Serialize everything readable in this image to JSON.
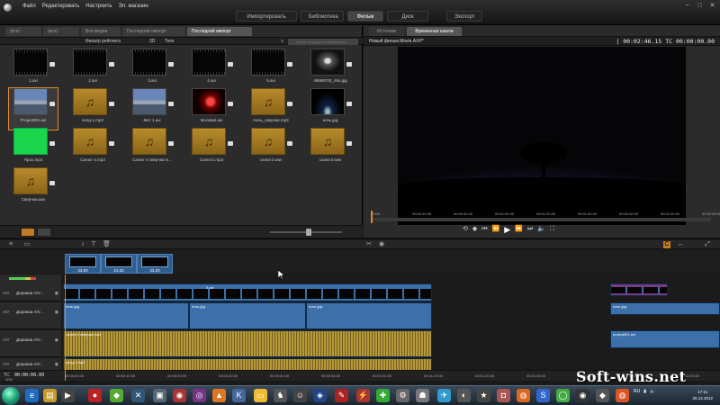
{
  "menu": {
    "items": [
      "Файл",
      "Редактировать",
      "Настроить",
      "Эл. магазин"
    ]
  },
  "window_controls": [
    "−",
    "□",
    "✕"
  ],
  "mode_tabs": {
    "import": "Импортировать",
    "library": "Библиотека",
    "movie": "Фильм",
    "disc": "Диск",
    "export": "Экспорт"
  },
  "library": {
    "tabs": [
      "(все)",
      "(все)",
      "Вся медиа",
      "Последний импорт",
      "Последний импорт"
    ],
    "rating_filter": "Фильтр рейтинга",
    "filter_3d": "3D",
    "filter_tags": "Теги",
    "search_placeholder": "Поиск текущих отображаемых",
    "items": [
      {
        "label": "1.avi",
        "kind": "film"
      },
      {
        "label": "2.avi",
        "kind": "film"
      },
      {
        "label": "3.avi",
        "kind": "film"
      },
      {
        "label": "4.avi",
        "kind": "film"
      },
      {
        "label": "5.avi",
        "kind": "film"
      },
      {
        "label": "49698700_n8o.jpg",
        "kind": "ufo"
      },
      {
        "label": "Project001.avi",
        "kind": "landscape"
      },
      {
        "label": "song-1.mp3",
        "kind": "audio"
      },
      {
        "label": "Мет 1.avi",
        "kind": "landscape"
      },
      {
        "label": "Москва2.avi",
        "kind": "rose"
      },
      {
        "label": "Ночь_сверчки.mp3",
        "kind": "audio"
      },
      {
        "label": "ночь.jpg",
        "kind": "night"
      },
      {
        "label": "Прох.mp4",
        "kind": "green"
      },
      {
        "label": "Салют 4.mp3",
        "kind": "audio"
      },
      {
        "label": "Салют и сверчки.m...",
        "kind": "audio"
      },
      {
        "label": "Салют1.mp3",
        "kind": "audio"
      },
      {
        "label": "салют2.wav",
        "kind": "audio"
      },
      {
        "label": "салют3.wav",
        "kind": "audio"
      },
      {
        "label": "Сверчки.wav",
        "kind": "audio"
      }
    ]
  },
  "preview": {
    "tabs": {
      "source": "Источник",
      "timeline": "Временная шкала"
    },
    "filename": "Новый фильм.Movie.AXP*",
    "timecode": "|  00:02:46.15  TC 00:00:00.00",
    "ruler": [
      "00:00",
      "00:00:20.00",
      "00:00:40.00",
      "00:01:00.00",
      "00:01:20.00",
      "00:01:40.00",
      "00:02:00.00",
      "00:02:20.00",
      "00:02:40.00"
    ]
  },
  "storyboard": {
    "clips": [
      "23.00",
      "21.03",
      "23.20"
    ]
  },
  "tracks": [
    {
      "num": "A/V",
      "name": "Дорожка A/V..."
    },
    {
      "num": "A/V",
      "name": "Дорожка A/V..."
    },
    {
      "num": "A/V",
      "name": "Дорожка A/V..."
    },
    {
      "num": "A/V",
      "name": "Дорожка A/V..."
    }
  ],
  "clips": {
    "t1a": "5.avi",
    "t2a": "ночь.jpg",
    "t2b": "ночь.jpg",
    "t2c": "ночь.jpg",
    "t2d": "ночь.jpg",
    "t3a": "салют и сверчки.mp3",
    "t3b": "project001.avi",
    "t4a": "song-1.mp3"
  },
  "timeline": {
    "tc_label": "TC",
    "tc": "00:00:00.00",
    "zoom": "40%",
    "ruler": [
      "00:00:00.00",
      "00:00:10.00",
      "00:00:20.00",
      "00:00:30.00",
      "00:00:40.00",
      "00:00:50.00",
      "00:01:00.00",
      "00:01:10.00",
      "00:01:20.00",
      "00:01:30.00",
      "00:01:40.00",
      "00:01:50.00",
      "00:02:00.00"
    ]
  },
  "taskbar": {
    "lang": "RU",
    "time": "17:11",
    "date": "25.12.2012"
  },
  "watermark": "Soft-wins.net"
}
